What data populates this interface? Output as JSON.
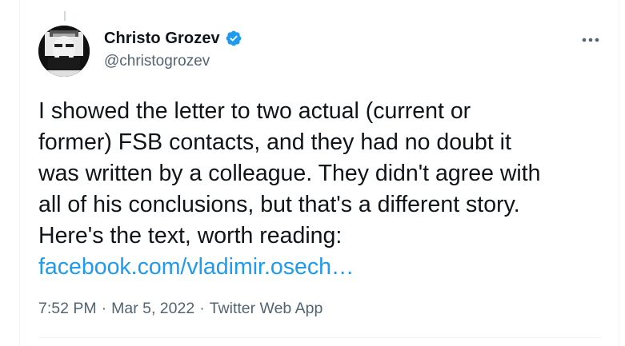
{
  "author": {
    "display_name": "Christo Grozev",
    "handle": "@christogrozev",
    "verified": true
  },
  "tweet": {
    "body": "I showed the letter to two actual (current or\nformer) FSB contacts, and they had no doubt it\nwas written by a colleague. They didn't agree with\nall of his conclusions, but that's a different story.\nHere's the text, worth reading:",
    "link_text": "facebook.com/vladimir.osech…"
  },
  "meta": {
    "time": "7:52 PM",
    "date": "Mar 5, 2022",
    "separator": "·",
    "source": "Twitter Web App"
  },
  "icons": {
    "verified": "verified-badge-icon",
    "more": "more-options-icon"
  },
  "colors": {
    "text": "#0f1419",
    "secondary": "#536471",
    "link": "#1d9bf0",
    "verified": "#1d9bf0",
    "border": "#eff3f4"
  }
}
